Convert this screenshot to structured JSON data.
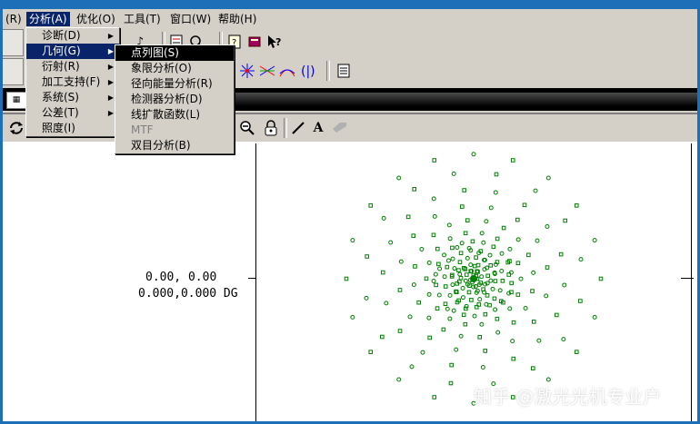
{
  "menubar": {
    "items": [
      {
        "label": "(R)"
      },
      {
        "label": "分析(A)"
      },
      {
        "label": "优化(O)"
      },
      {
        "label": "工具(T)"
      },
      {
        "label": "窗口(W)"
      },
      {
        "label": "帮助(H)"
      }
    ]
  },
  "analysis_menu": {
    "items": [
      {
        "label": "诊断(D)"
      },
      {
        "label": "几何(G)"
      },
      {
        "label": "衍射(R)"
      },
      {
        "label": "加工支持(F)"
      },
      {
        "label": "系统(S)"
      },
      {
        "label": "公差(T)"
      },
      {
        "label": "照度(I)"
      }
    ]
  },
  "geometry_submenu": {
    "items": [
      {
        "label": "点列图(S)"
      },
      {
        "label": "象限分析(O)"
      },
      {
        "label": "径向能量分析(R)"
      },
      {
        "label": "检测器分析(D)"
      },
      {
        "label": "线扩散函数(L)"
      },
      {
        "label": "MTF"
      },
      {
        "label": "双目分析(B)"
      }
    ]
  },
  "plot": {
    "readout_line1": "0.00, 0.00",
    "readout_line2": "0.000,0.000 DG",
    "spot_color": "#008000"
  },
  "plot_toolbar": {
    "text_tool_label": "A"
  },
  "watermark": "知乎 @激光光机专业户",
  "colors": {
    "menu_highlight": "#0a246a",
    "window_face": "#d4d0c8",
    "frame_blue": "#1d6fb8"
  }
}
